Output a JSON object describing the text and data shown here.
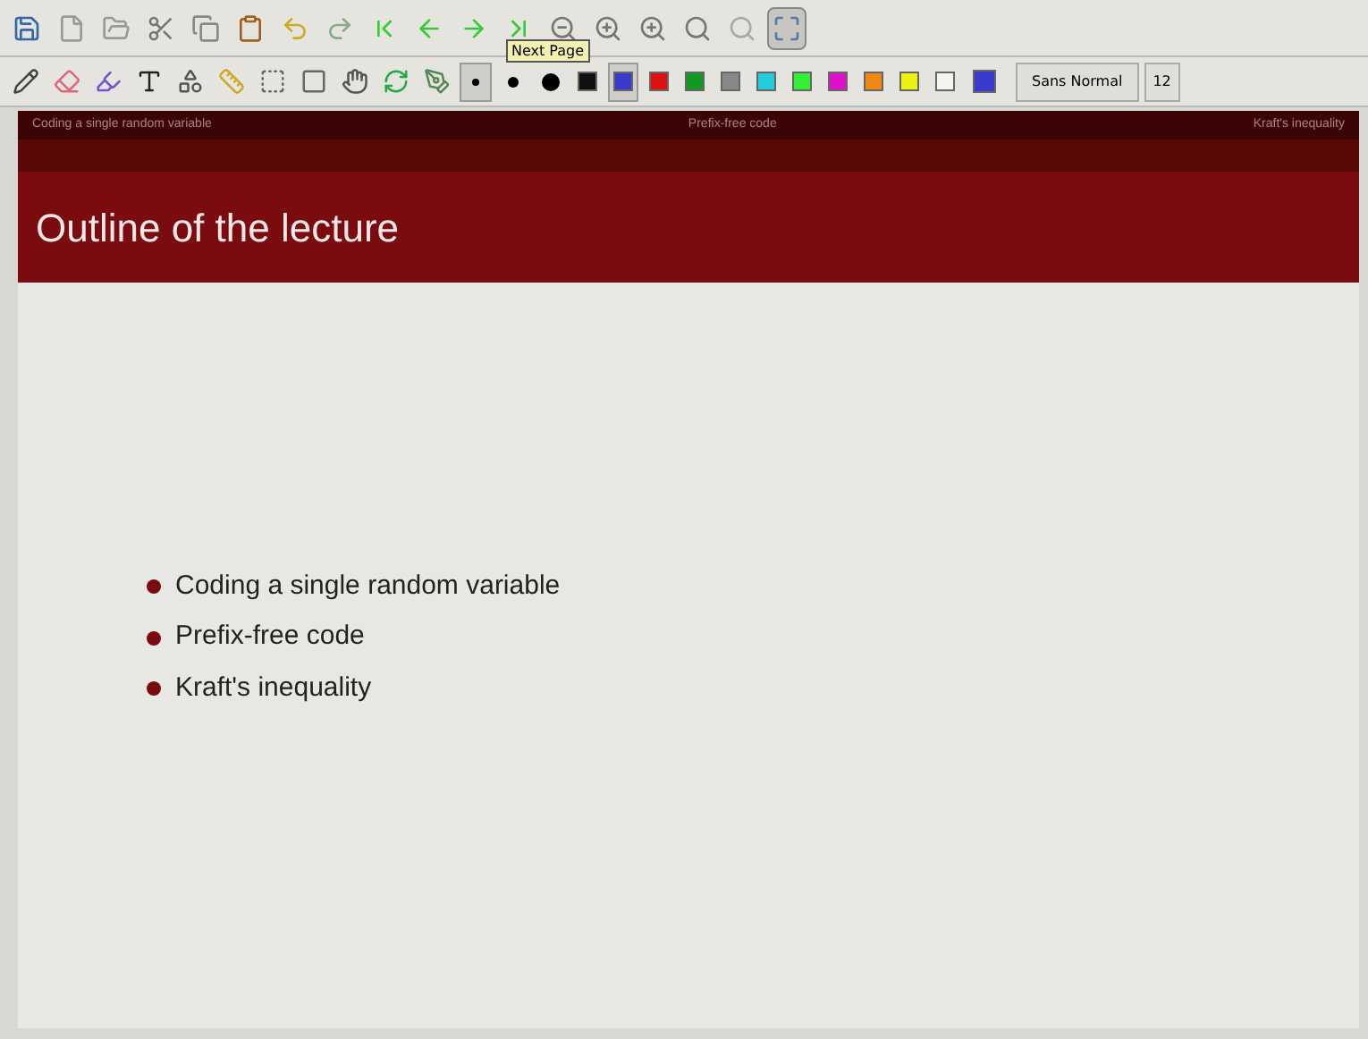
{
  "toolbar": {
    "tools": [
      {
        "selected": false
      },
      {
        "selected": false
      },
      {
        "selected": false
      },
      {
        "selected": false
      },
      {
        "selected": false
      },
      {
        "selected": false
      },
      {
        "selected": false
      },
      {
        "selected": false
      },
      {
        "selected": false
      },
      {
        "selected": false
      },
      {
        "selected": false
      },
      {
        "selected": false
      },
      {
        "selected": false
      },
      {
        "selected": false
      },
      {
        "selected": false
      },
      {
        "selected": false
      },
      {
        "selected": false
      },
      {
        "selected": true
      }
    ],
    "tooltip": "Next Page"
  },
  "drawbar": {
    "pen_sizes": [
      {
        "selected": true
      },
      {
        "selected": false
      },
      {
        "selected": false
      }
    ],
    "colors": [
      {
        "color": "#111111",
        "selected": false
      },
      {
        "color": "#3a3acc",
        "selected": true
      },
      {
        "color": "#dd1111",
        "selected": false
      },
      {
        "color": "#119922",
        "selected": false
      },
      {
        "color": "#888888",
        "selected": false
      },
      {
        "color": "#22ccdd",
        "selected": false
      },
      {
        "color": "#33ee33",
        "selected": false
      },
      {
        "color": "#dd11cc",
        "selected": false
      },
      {
        "color": "#ee8811",
        "selected": false
      },
      {
        "color": "#eeee11",
        "selected": false
      },
      {
        "color": "#f4f4f0",
        "selected": false
      }
    ],
    "custom_swatch": {
      "color": "#3a3acc"
    },
    "font": "Sans Normal",
    "font_size": "12"
  },
  "slide": {
    "nav": [
      "Coding a single random variable",
      "Prefix-free code",
      "Kraft's inequality"
    ],
    "title": "Outline of the lecture",
    "items": [
      "Coding a single random variable",
      "Prefix-free code",
      "Kraft's inequality"
    ]
  }
}
